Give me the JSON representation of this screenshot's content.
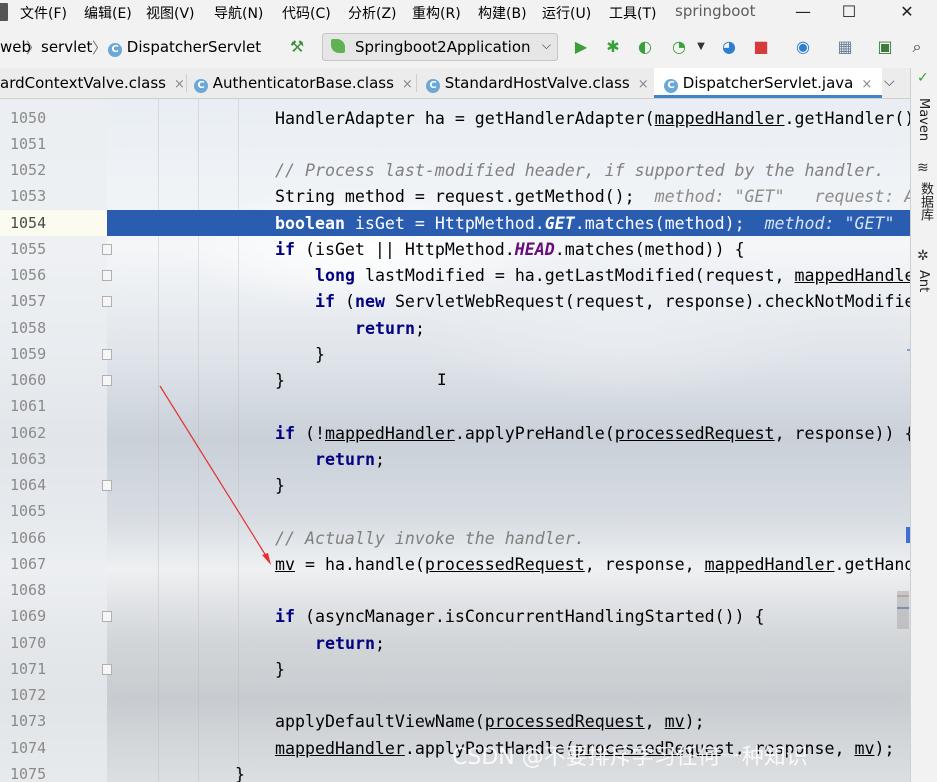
{
  "menu": {
    "items": [
      "文件(F)",
      "编辑(E)",
      "视图(V)",
      "导航(N)",
      "代码(C)",
      "分析(Z)",
      "重构(R)",
      "构建(B)",
      "运行(U)",
      "工具(T)"
    ],
    "project": "springboot",
    "window_controls": {
      "minimize": "—",
      "maximize": "☐",
      "close": "✕"
    }
  },
  "breadcrumb": {
    "items": [
      "web",
      "servlet",
      "DispatcherServlet"
    ],
    "sep": "〉"
  },
  "run_config": {
    "label": "Springboot2Application",
    "caret": "⌵"
  },
  "tabs": [
    {
      "label": "ardContextValve.class",
      "close": "×"
    },
    {
      "label": "AuthenticatorBase.class",
      "close": "×"
    },
    {
      "label": "StandardHostValve.class",
      "close": "×"
    },
    {
      "label": "DispatcherServlet.java",
      "close": "×",
      "active": true
    }
  ],
  "tab_overflow": "⌵",
  "right_strip": [
    "Maven",
    "数据库",
    "Ant"
  ],
  "line_numbers": [
    "1050",
    "1051",
    "1052",
    "1053",
    "1054",
    "1055",
    "1056",
    "1057",
    "1058",
    "1059",
    "1060",
    "1061",
    "1062",
    "1063",
    "1064",
    "1065",
    "1066",
    "1067",
    "1068",
    "1069",
    "1070",
    "1071",
    "1072",
    "1073",
    "1074",
    "1075"
  ],
  "code": {
    "l1050": {
      "a": "HandlerAdapter ha = getHandlerAdapter(",
      "b": "mappedHandler",
      "c": ".getHandler());"
    },
    "l1052": {
      "a": "// Process last-modified header, if supported by the handler."
    },
    "l1053": {
      "a": "String method = request.getMethod();",
      "hint": "method: \"GET\"   request: Ap"
    },
    "l1054": {
      "kw": "boolean",
      "a": " isGet = HttpMethod.",
      "st": "GET",
      "b": ".matches(method);",
      "hint": "method: \"GET\""
    },
    "l1055": {
      "kw": "if",
      "a": " (isGet || HttpMethod.",
      "st": "HEAD",
      "b": ".matches(method)) {"
    },
    "l1056": {
      "kw": "long",
      "a": " lastModified = ha.getLastModified(request, ",
      "b": "mappedHandle"
    },
    "l1057": {
      "kw": "if",
      "a": " (",
      "kw2": "new",
      "b": " ServletWebRequest(request, response).checkNotModifie"
    },
    "l1058": {
      "kw": "return",
      "a": ";"
    },
    "l1059": {
      "a": "}"
    },
    "l1060": {
      "a": "}"
    },
    "l1062": {
      "kw": "if",
      "a": " (!",
      "b": "mappedHandler",
      "c": ".applyPreHandle(",
      "d": "processedRequest",
      "e": ", response)) {"
    },
    "l1063": {
      "kw": "return",
      "a": ";"
    },
    "l1064": {
      "a": "}"
    },
    "l1066": {
      "a": "// Actually invoke the handler."
    },
    "l1067": {
      "a": "mv",
      "b": " = ha.handle(",
      "c": "processedRequest",
      "d": ", response, ",
      "e": "mappedHandler",
      "f": ".getHand"
    },
    "l1069": {
      "kw": "if",
      "a": " (asyncManager.isConcurrentHandlingStarted()) {"
    },
    "l1070": {
      "kw": "return",
      "a": ";"
    },
    "l1071": {
      "a": "}"
    },
    "l1073": {
      "a": "applyDefaultViewName(",
      "b": "processedRequest",
      "c": ", ",
      "d": "mv",
      "e": ");"
    },
    "l1074": {
      "a": "mappedHandler",
      "b": ".applyPostHandle(",
      "c": "processedRequest",
      "d": ", response, ",
      "e": "mv",
      "f": ");"
    },
    "l1075": {
      "a": "}"
    }
  },
  "watermark": "CSDN @不要排斥学习任何一种知识",
  "colors": {
    "selection": "#2a5db0",
    "keyword": "#000080",
    "comment": "#808080",
    "static_field": "#660e7a",
    "arrow": "#e53030",
    "tab_active": "#4083c9"
  }
}
